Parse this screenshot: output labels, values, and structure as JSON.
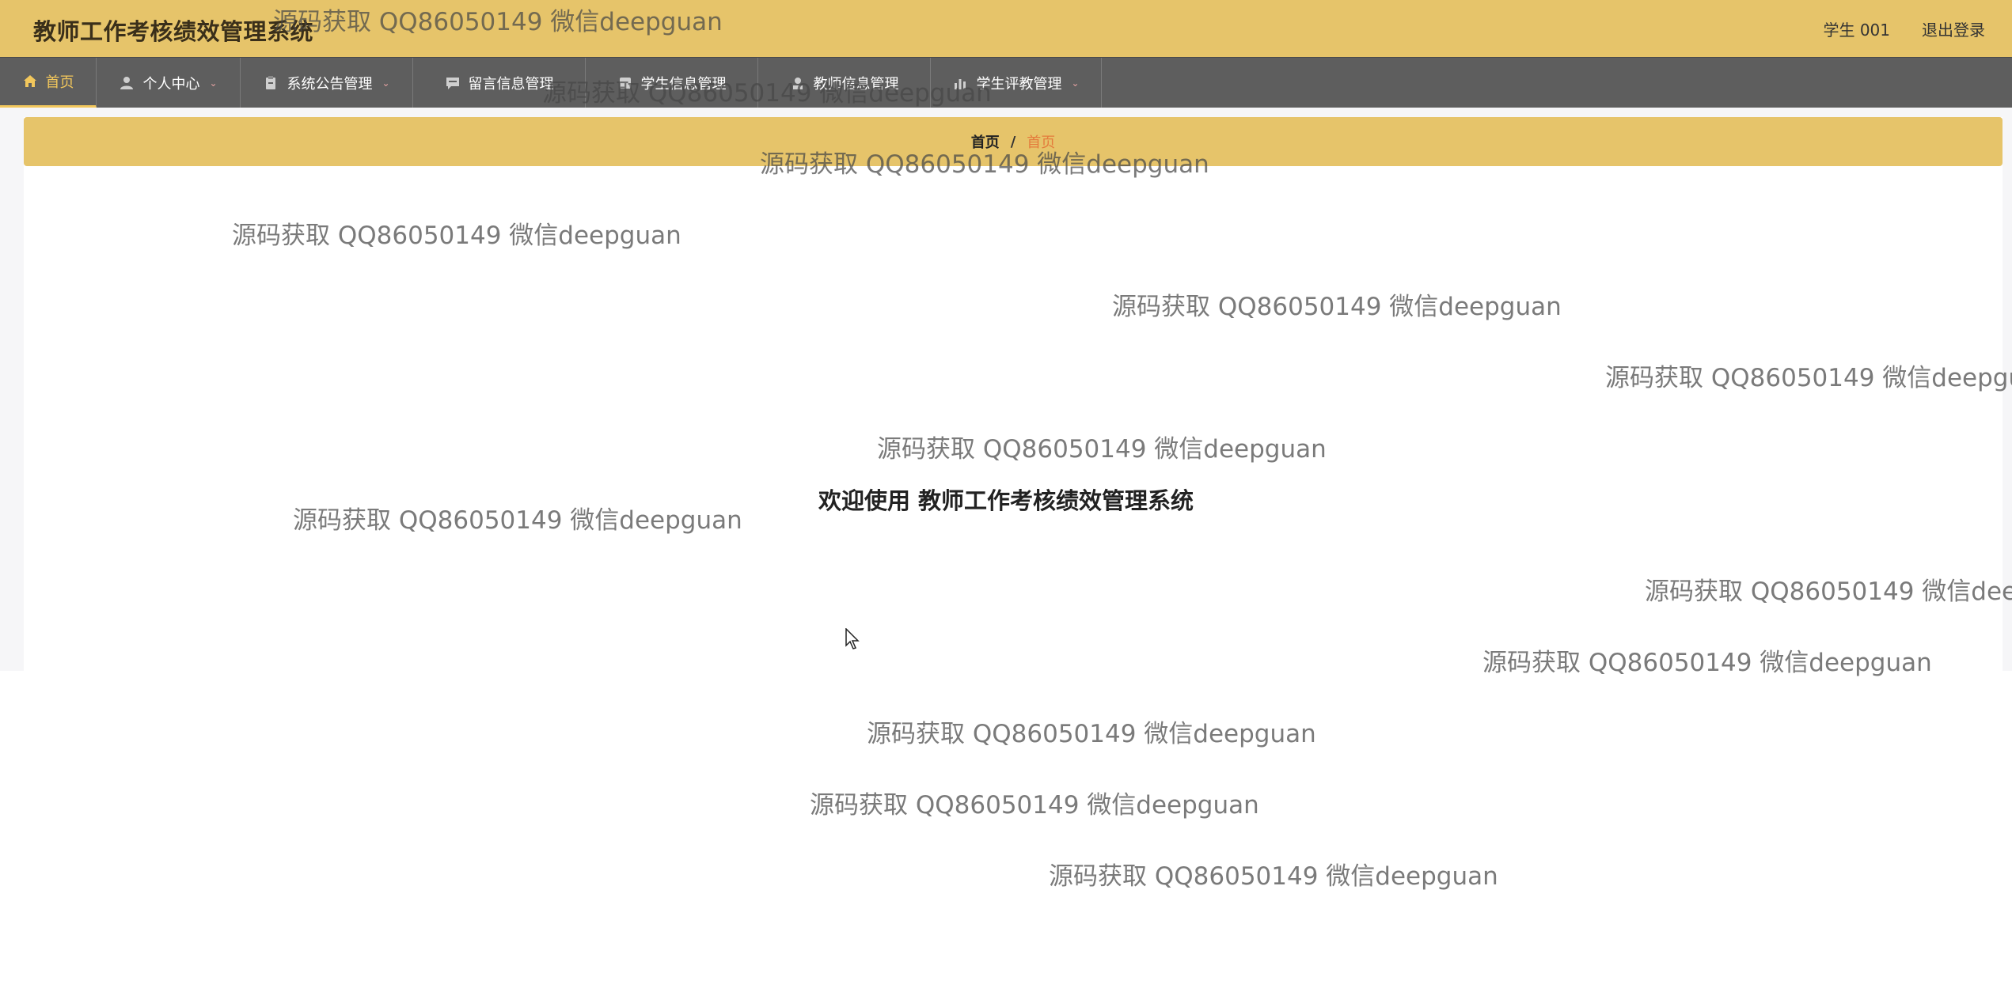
{
  "header": {
    "title": "教师工作考核绩效管理系统",
    "user_label": "学生 001",
    "logout_label": "退出登录"
  },
  "nav": {
    "items": [
      {
        "label": "首页",
        "icon": "home-icon"
      },
      {
        "label": "个人中心",
        "icon": "user-icon"
      },
      {
        "label": "系统公告管理",
        "icon": "clipboard-icon"
      },
      {
        "label": "留言信息管理",
        "icon": "chat-icon"
      },
      {
        "label": "学生信息管理",
        "icon": "student-icon"
      },
      {
        "label": "教师信息管理",
        "icon": "teacher-icon"
      },
      {
        "label": "学生评教管理",
        "icon": "chart-icon"
      }
    ]
  },
  "breadcrumb": {
    "home": "首页",
    "separator": "/",
    "current": "首页"
  },
  "main": {
    "welcome": "欢迎使用 教师工作考核绩效管理系统"
  },
  "watermark": {
    "text": "源码获取 QQ86050149 微信deepguan"
  },
  "colors": {
    "header_bg": "#e6c46a",
    "nav_bg": "#5e5e5e",
    "active": "#f2c75c",
    "crumb_current": "#e47b3c"
  }
}
